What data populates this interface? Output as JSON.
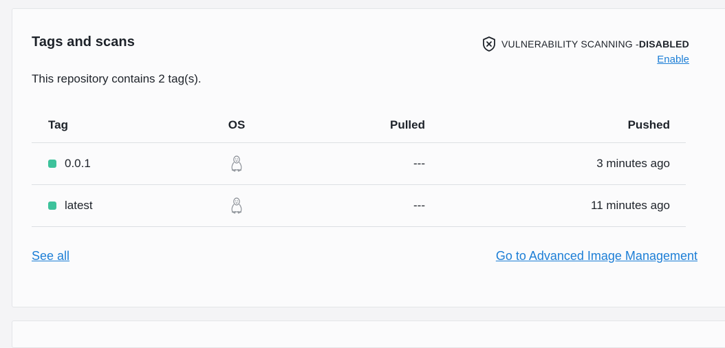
{
  "card": {
    "title": "Tags and scans",
    "subtitle": "This repository contains 2 tag(s).",
    "scanning": {
      "label": "VULNERABILITY SCANNING - ",
      "status": "DISABLED",
      "enable_link": "Enable",
      "icon": "shield-x-icon"
    },
    "table": {
      "headers": {
        "tag": "Tag",
        "os": "OS",
        "pulled": "Pulled",
        "pushed": "Pushed"
      },
      "rows": [
        {
          "tag": "0.0.1",
          "os_icon": "linux-penguin-icon",
          "pulled": "---",
          "pushed": "3 minutes ago"
        },
        {
          "tag": "latest",
          "os_icon": "linux-penguin-icon",
          "pulled": "---",
          "pushed": "11 minutes ago"
        }
      ]
    },
    "links": {
      "see_all": "See all",
      "advanced": "Go to Advanced Image Management"
    }
  },
  "colors": {
    "link": "#1c7ed6",
    "tag_dot": "#3dc29b"
  }
}
